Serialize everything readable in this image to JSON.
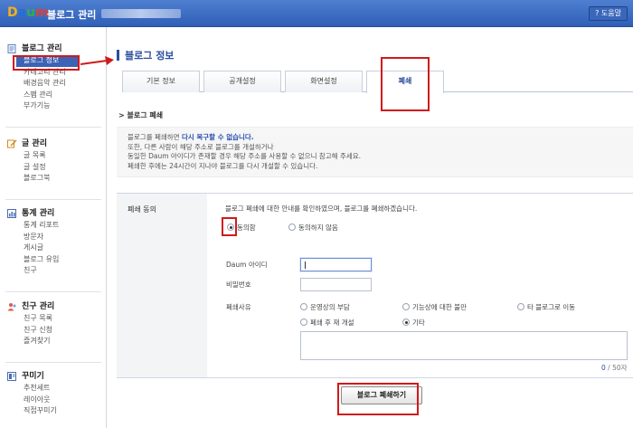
{
  "topbar": {
    "logo_letters": [
      "D",
      "a",
      "u",
      "m"
    ],
    "logo_colors": [
      "#f2b01b",
      "#1f6fd6",
      "#2fae4c",
      "#e0402f"
    ],
    "title": "블로그 관리",
    "help_label": "? 도움말"
  },
  "sidebar": {
    "groups": [
      {
        "title": "블로그 관리",
        "icon": "document-icon",
        "items": [
          "블로그 정보",
          "카테고리 관리",
          "배경음악 관리",
          "스팸 관리",
          "부가기능"
        ]
      },
      {
        "title": "글 관리",
        "icon": "pencil-icon",
        "items": [
          "글 목록",
          "글 설정",
          "블로그북"
        ]
      },
      {
        "title": "통계 관리",
        "icon": "chart-icon",
        "items": [
          "통계 리포트",
          "방문자",
          "게시글",
          "블로그 유입",
          "친구"
        ]
      },
      {
        "title": "친구 관리",
        "icon": "people-icon",
        "items": [
          "친구 목록",
          "친구 신청",
          "즐겨찾기"
        ]
      },
      {
        "title": "꾸미기",
        "icon": "layout-icon",
        "items": [
          "추천세트",
          "레이아웃",
          "직접꾸미기"
        ]
      }
    ]
  },
  "page": {
    "title": "블로그 정보",
    "tabs": [
      "기본 정보",
      "공개설정",
      "화면설정",
      "폐쇄"
    ],
    "active_tab": "폐쇄",
    "section_title": "> 블로그 폐쇄",
    "notice": {
      "line1_prefix": "블로그를 폐쇄하면 ",
      "line1_highlight": "다시 복구할 수 없습니다.",
      "line2": "또한, 다른 사람이 해당 주소로 블로그를 개설하거나",
      "line3": "동일한 Daum 아이디가 존재할 경우 해당 주소를 사용할 수 없으니 참고해 주세요.",
      "line4": "폐쇄한 후에는 24시간이 지나야 블로그를 다시 개설할 수 있습니다."
    },
    "form": {
      "row_label": "폐쇄 동의",
      "agree_text": "블로그 폐쇄에 대한 안내를 확인하였으며, 블로그를 폐쇄하겠습니다.",
      "agree_option": "동의함",
      "disagree_option": "동의하지 않음",
      "daum_id_label": "Daum 아이디",
      "password_label": "비밀번호",
      "reason_label": "폐쇄사유",
      "reasons": [
        "운영상의 부담",
        "기능상에 대한 불만",
        "타 블로그로 이동",
        "폐쇄 후 재 개설",
        "기타"
      ],
      "selected_reason": "기타",
      "counter_current": "0",
      "counter_rest": " / 50자"
    },
    "submit_label": "블로그 폐쇄하기"
  }
}
